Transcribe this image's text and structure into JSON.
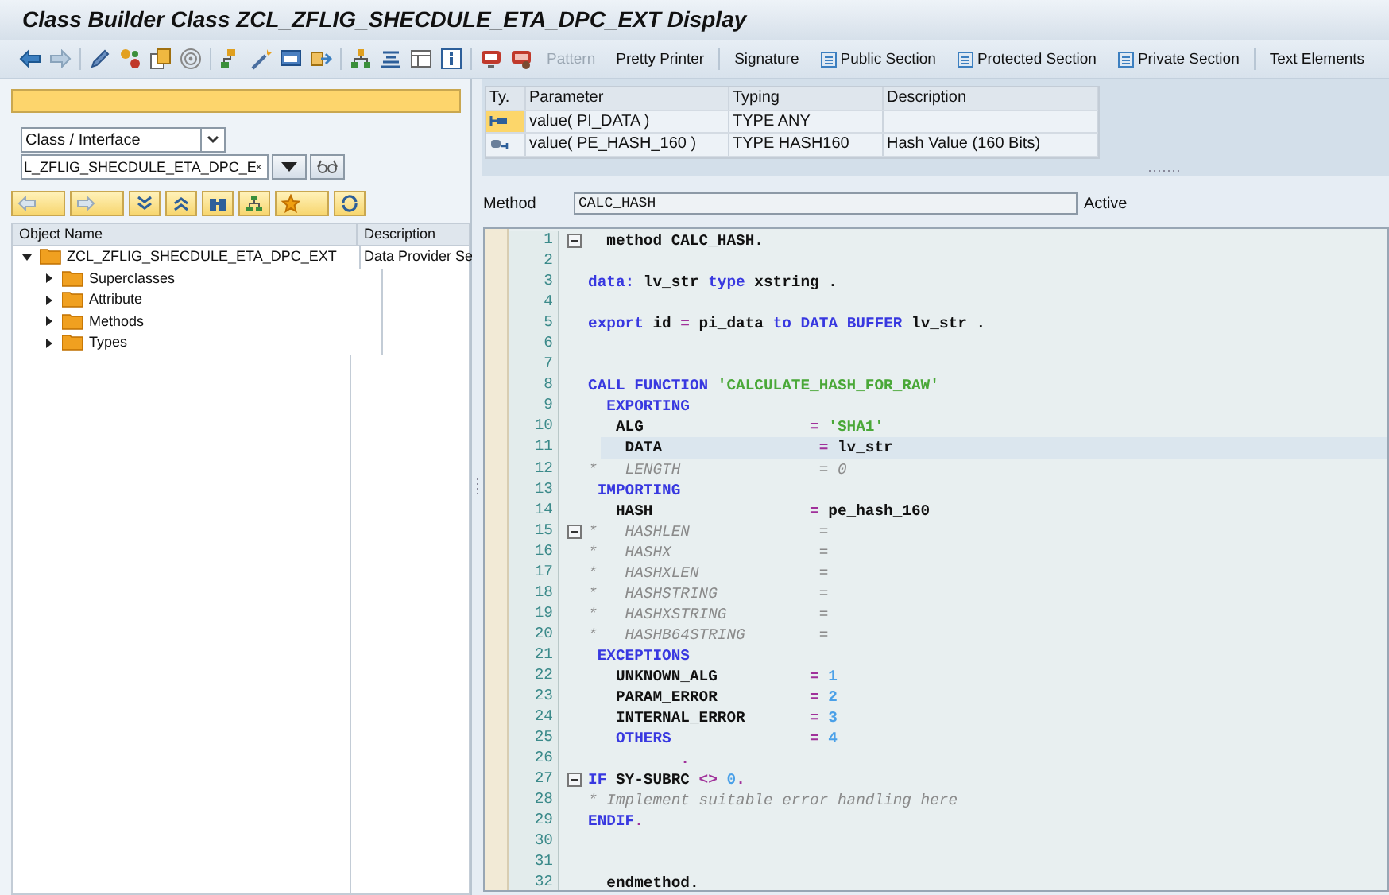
{
  "window": {
    "title": "Class Builder Class ZCL_ZFLIG_SHECDULE_ETA_DPC_EXT Display"
  },
  "toolbar": {
    "buttons": [
      {
        "label": "Pattern",
        "disabled": true,
        "icon": false
      },
      {
        "label": "Pretty Printer",
        "disabled": false,
        "icon": false
      },
      {
        "label": "Signature",
        "disabled": false,
        "icon": false
      },
      {
        "label": "Public Section",
        "disabled": false,
        "icon": true
      },
      {
        "label": "Protected Section",
        "disabled": false,
        "icon": true
      },
      {
        "label": "Private Section",
        "disabled": false,
        "icon": true
      },
      {
        "label": "Text Elements",
        "disabled": false,
        "icon": false
      }
    ]
  },
  "navigator": {
    "object_type": "Class / Interface",
    "object_name": "L_ZFLIG_SHECDULE_ETA_DPC_E",
    "tree": {
      "columns": [
        "Object Name",
        "Description"
      ],
      "items": [
        {
          "label": "ZCL_ZFLIG_SHECDULE_ETA_DPC_EXT",
          "description": "Data Provider Se",
          "expanded": true,
          "children": [
            {
              "label": "Superclasses",
              "expanded": false
            },
            {
              "label": "Attribute",
              "expanded": false
            },
            {
              "label": "Methods",
              "expanded": false
            },
            {
              "label": "Types",
              "expanded": false
            }
          ]
        }
      ]
    }
  },
  "parameters": {
    "columns": [
      "Ty.",
      "Parameter",
      "Typing",
      "Description"
    ],
    "rows": [
      {
        "kind": "importing",
        "selected": true,
        "parameter": "value( PI_DATA )",
        "typing": "TYPE ANY"
      },
      {
        "kind": "exporting",
        "selected": false,
        "parameter": "value( PE_HASH_160 )",
        "typing": "TYPE HASH160",
        "description": "Hash Value (160 Bits)"
      }
    ]
  },
  "method": {
    "label": "Method",
    "value": "CALC_HASH",
    "status": "Active"
  },
  "editor": {
    "lines": [
      {
        "number": "1",
        "fold": true,
        "current": false,
        "tokens": [
          {
            "kind": "id",
            "text": "  method CALC_HASH."
          }
        ]
      },
      {
        "number": "2",
        "fold": false,
        "current": false
      },
      {
        "number": "3",
        "fold": false,
        "current": false,
        "tokens": [
          {
            "kind": "kw",
            "text": "data:"
          },
          {
            "kind": "id",
            "text": " lv_str "
          },
          {
            "kind": "kw",
            "text": "type"
          },
          {
            "kind": "id",
            "text": " xstring ."
          }
        ]
      },
      {
        "number": "4",
        "fold": false,
        "current": false
      },
      {
        "number": "5",
        "fold": false,
        "current": false,
        "tokens": [
          {
            "kind": "kw",
            "text": "export"
          },
          {
            "kind": "id",
            "text": " id "
          },
          {
            "kind": "op",
            "text": "="
          },
          {
            "kind": "id",
            "text": " pi_data "
          },
          {
            "kind": "kw",
            "text": "to DATA BUFFER"
          },
          {
            "kind": "id",
            "text": " lv_str ."
          }
        ]
      },
      {
        "number": "6",
        "fold": false,
        "current": false
      },
      {
        "number": "7",
        "fold": false,
        "current": false
      },
      {
        "number": "8",
        "fold": false,
        "current": false,
        "tokens": [
          {
            "kind": "kw",
            "text": "CALL FUNCTION"
          },
          {
            "kind": "str",
            "text": " 'CALCULATE_HASH_FOR_RAW'"
          }
        ]
      },
      {
        "number": "9",
        "fold": false,
        "current": false,
        "tokens": [
          {
            "kind": "kw",
            "text": "  EXPORTING"
          }
        ]
      },
      {
        "number": "10",
        "fold": false,
        "current": false,
        "tokens": [
          {
            "kind": "id",
            "text": "   ALG                  "
          },
          {
            "kind": "op",
            "text": "="
          },
          {
            "kind": "str",
            "text": " 'SHA1'"
          }
        ]
      },
      {
        "number": "11",
        "fold": false,
        "current": true,
        "tokens": [
          {
            "kind": "id",
            "text": "    DATA                 "
          },
          {
            "kind": "op",
            "text": "="
          },
          {
            "kind": "id",
            "text": " lv_str"
          }
        ]
      },
      {
        "number": "12",
        "fold": false,
        "current": false,
        "tokens": [
          {
            "kind": "cmt",
            "text": "*   LENGTH               = 0"
          }
        ]
      },
      {
        "number": "13",
        "fold": false,
        "current": false,
        "tokens": [
          {
            "kind": "kw",
            "text": " IMPORTING"
          }
        ]
      },
      {
        "number": "14",
        "fold": false,
        "current": false,
        "tokens": [
          {
            "kind": "id",
            "text": "   HASH                 "
          },
          {
            "kind": "op",
            "text": "="
          },
          {
            "kind": "id",
            "text": " pe_hash_160"
          }
        ]
      },
      {
        "number": "15",
        "fold": true,
        "current": false,
        "tokens": [
          {
            "kind": "cmt",
            "text": "*   HASHLEN              ="
          }
        ]
      },
      {
        "number": "16",
        "fold": false,
        "current": false,
        "tokens": [
          {
            "kind": "cmt",
            "text": "*   HASHX                ="
          }
        ]
      },
      {
        "number": "17",
        "fold": false,
        "current": false,
        "tokens": [
          {
            "kind": "cmt",
            "text": "*   HASHXLEN             ="
          }
        ]
      },
      {
        "number": "18",
        "fold": false,
        "current": false,
        "tokens": [
          {
            "kind": "cmt",
            "text": "*   HASHSTRING           ="
          }
        ]
      },
      {
        "number": "19",
        "fold": false,
        "current": false,
        "tokens": [
          {
            "kind": "cmt",
            "text": "*   HASHXSTRING          ="
          }
        ]
      },
      {
        "number": "20",
        "fold": false,
        "current": false,
        "tokens": [
          {
            "kind": "cmt",
            "text": "*   HASHB64STRING        ="
          }
        ]
      },
      {
        "number": "21",
        "fold": false,
        "current": false,
        "tokens": [
          {
            "kind": "kw",
            "text": " EXCEPTIONS"
          }
        ]
      },
      {
        "number": "22",
        "fold": false,
        "current": false,
        "tokens": [
          {
            "kind": "id",
            "text": "   UNKNOWN_ALG          "
          },
          {
            "kind": "op",
            "text": "="
          },
          {
            "kind": "num",
            "text": " 1"
          }
        ]
      },
      {
        "number": "23",
        "fold": false,
        "current": false,
        "tokens": [
          {
            "kind": "id",
            "text": "   PARAM_ERROR          "
          },
          {
            "kind": "op",
            "text": "="
          },
          {
            "kind": "num",
            "text": " 2"
          }
        ]
      },
      {
        "number": "24",
        "fold": false,
        "current": false,
        "tokens": [
          {
            "kind": "id",
            "text": "   INTERNAL_ERROR       "
          },
          {
            "kind": "op",
            "text": "="
          },
          {
            "kind": "num",
            "text": " 3"
          }
        ]
      },
      {
        "number": "25",
        "fold": false,
        "current": false,
        "tokens": [
          {
            "kind": "kw",
            "text": "   OTHERS"
          },
          {
            "kind": "op",
            "text": "               ="
          },
          {
            "kind": "num",
            "text": " 4"
          }
        ]
      },
      {
        "number": "26",
        "fold": false,
        "current": false,
        "tokens": [
          {
            "kind": "op",
            "text": "          ."
          }
        ]
      },
      {
        "number": "27",
        "fold": true,
        "current": false,
        "tokens": [
          {
            "kind": "kw",
            "text": "IF"
          },
          {
            "kind": "id",
            "text": " SY-SUBRC "
          },
          {
            "kind": "op",
            "text": "<>"
          },
          {
            "kind": "num",
            "text": " 0"
          },
          {
            "kind": "op",
            "text": "."
          }
        ]
      },
      {
        "number": "28",
        "fold": false,
        "current": false,
        "tokens": [
          {
            "kind": "cmt",
            "text": "* Implement suitable error handling here"
          }
        ]
      },
      {
        "number": "29",
        "fold": false,
        "current": false,
        "tokens": [
          {
            "kind": "kw",
            "text": "ENDIF"
          },
          {
            "kind": "op",
            "text": "."
          }
        ]
      },
      {
        "number": "30",
        "fold": false,
        "current": false
      },
      {
        "number": "31",
        "fold": false,
        "current": false
      },
      {
        "number": "32",
        "fold": false,
        "current": false,
        "tokens": [
          {
            "kind": "id",
            "text": "  endmethod."
          }
        ]
      }
    ]
  }
}
